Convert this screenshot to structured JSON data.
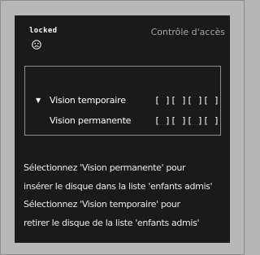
{
  "status": {
    "label": "locked",
    "icon": "sad-face-icon"
  },
  "header": {
    "title": "Contrôle d'accès"
  },
  "options": [
    {
      "label": "Vision temporaire",
      "selected": true,
      "slots": [
        "[ ]",
        "[ ]",
        "[ ]",
        "[ ]"
      ]
    },
    {
      "label": "Vision permanente",
      "selected": false,
      "slots": [
        "[ ]",
        "[ ]",
        "[ ]",
        "[ ]"
      ]
    }
  ],
  "cursor_symbol": "▼",
  "help": {
    "line1": "Sélectionnez 'Vision permanente' pour",
    "line2": "insérer le disque dans la liste 'enfants admis'",
    "line3": "Sélectionnez 'Vision temporaire' pour",
    "line4": "retirer le disque de la liste 'enfants admis'"
  },
  "colors": {
    "screen_bg": "#1a1a1a",
    "frame_bg": "#b8b8b8",
    "title_color": "#a6a6a6",
    "text_color": "#ffffff"
  }
}
